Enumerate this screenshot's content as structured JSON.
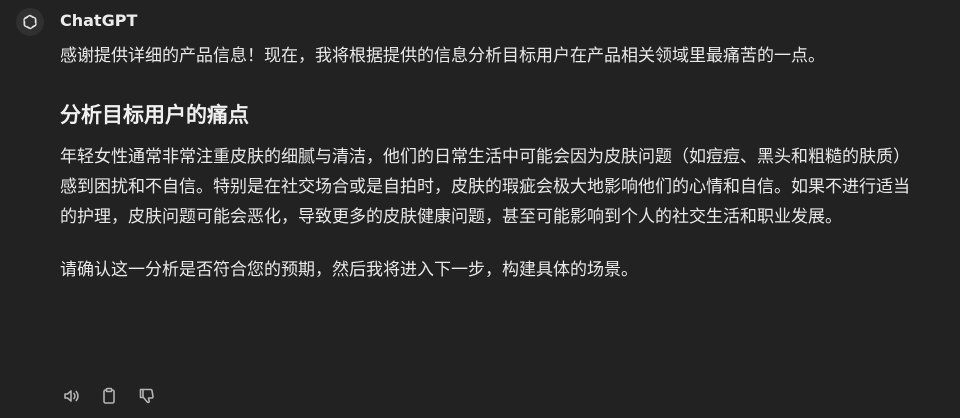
{
  "message": {
    "sender": "ChatGPT",
    "intro": "感谢提供详细的产品信息！现在，我将根据提供的信息分析目标用户在产品相关领域里最痛苦的一点。",
    "heading": "分析目标用户的痛点",
    "body": "年轻女性通常非常注重皮肤的细腻与清洁，他们的日常生活中可能会因为皮肤问题（如痘痘、黑头和粗糙的肤质）感到困扰和不自信。特别是在社交场合或是自拍时，皮肤的瑕疵会极大地影响他们的心情和自信。如果不进行适当的护理，皮肤问题可能会恶化，导致更多的皮肤健康问题，甚至可能影响到个人的社交生活和职业发展。",
    "closing": "请确认这一分析是否符合您的预期，然后我将进入下一步，构建具体的场景。"
  },
  "actions": [
    {
      "icon": "speaker-icon"
    },
    {
      "icon": "clipboard-icon"
    },
    {
      "icon": "thumbs-down-icon"
    }
  ],
  "colors": {
    "background": "#222222",
    "text": "#ececec",
    "icon": "#b4b4b4"
  }
}
